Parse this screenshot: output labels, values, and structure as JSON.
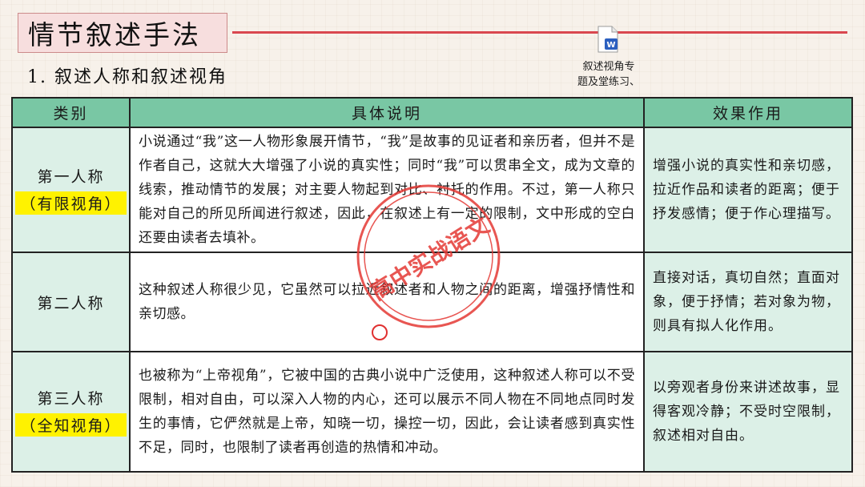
{
  "header": {
    "title": "情节叙述手法",
    "subtitle": "1. 叙述人称和叙述视角"
  },
  "attachment": {
    "icon": "word-file-icon",
    "badge": "W",
    "caption_line1": "叙述视角专",
    "caption_line2": "题及堂练习、"
  },
  "stamp": {
    "text": "高中实战语文"
  },
  "table": {
    "headers": [
      "类别",
      "具体说明",
      "效果作用"
    ],
    "rows": [
      {
        "category": "第一人称",
        "tag": "（有限视角）",
        "description": "小说通过“我”这一人物形象展开情节，“我”是故事的见证者和亲历者，但并不是作者自己，这就大大增强了小说的真实性；同时“我”可以贯串全文，成为文章的线索，推动情节的发展；对主要人物起到对比、衬托的作用。不过，第一人称只能对自己的所见所闻进行叙述，因此，在叙述上有一定的限制，文中形成的空白还要由读者去填补。",
        "effect": "增强小说的真实性和亲切感，拉近作品和读者的距离；便于抒发感情；便于作心理描写。"
      },
      {
        "category": "第二人称",
        "tag": "",
        "description": "这种叙述人称很少见，它虽然可以拉近叙述者和人物之间的距离，增强抒情性和亲切感。",
        "effect": "直接对话，真切自然；直面对象，便于抒情；若对象为物，则具有拟人化作用。"
      },
      {
        "category": "第三人称",
        "tag": "（全知视角）",
        "description": "也被称为“上帝视角”，它被中国的古典小说中广泛使用，这种叙述人称可以不受限制，相对自由，可以深入人物的内心，还可以展示不同人物在不同地点同时发生的事情，它俨然就是上帝，知晓一切，操控一切，因此，会让读者感到真实性不足，同时，也限制了读者再创造的热情和冲动。",
        "effect": "以旁观者身份来讲述故事，显得客观冷静；不受时空限制，叙述相对自由。"
      }
    ]
  }
}
